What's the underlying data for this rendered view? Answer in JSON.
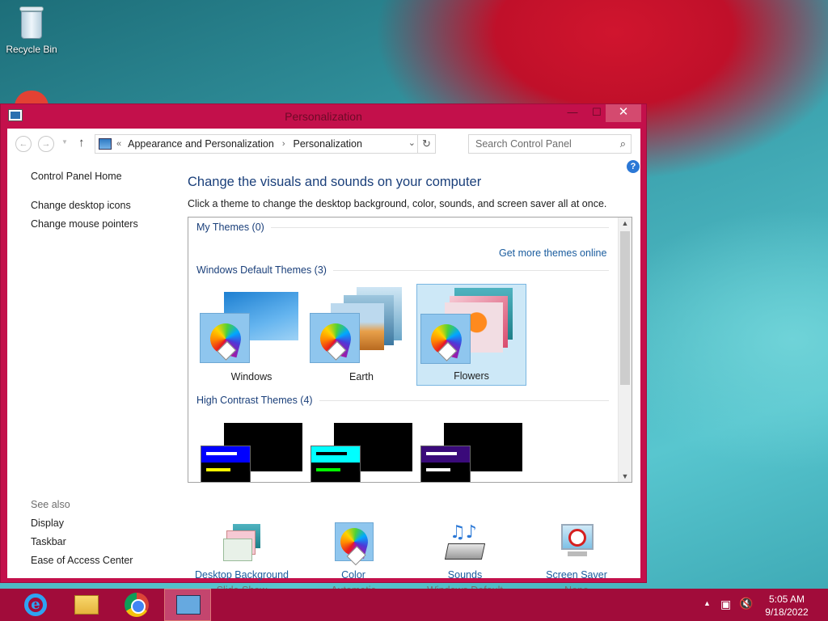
{
  "desktop": {
    "recycle_bin_label": "Recycle Bin"
  },
  "window": {
    "title": "Personalization",
    "controls": {
      "minimize": "—",
      "maximize": "☐",
      "close": "✕"
    }
  },
  "address": {
    "overflow": "«",
    "crumbs": [
      "Appearance and Personalization",
      "Personalization"
    ],
    "separator": "›"
  },
  "search": {
    "placeholder": "Search Control Panel"
  },
  "left_nav": {
    "home": "Control Panel Home",
    "items": [
      "Change desktop icons",
      "Change mouse pointers"
    ],
    "see_also_heading": "See also",
    "see_also": [
      "Display",
      "Taskbar",
      "Ease of Access Center"
    ]
  },
  "main": {
    "heading": "Change the visuals and sounds on your computer",
    "subheading": "Click a theme to change the desktop background, color, sounds, and screen saver all at once.",
    "help": "?"
  },
  "themes": {
    "my_themes_heading": "My Themes (0)",
    "get_more_link": "Get more themes online",
    "default_heading": "Windows Default Themes (3)",
    "default_themes": [
      {
        "name": "Windows",
        "selected": false
      },
      {
        "name": "Earth",
        "selected": false
      },
      {
        "name": "Flowers",
        "selected": true
      }
    ],
    "high_contrast_heading": "High Contrast Themes (4)",
    "hc_colors": [
      {
        "bar": "#0000ff",
        "l1": "#ffffff",
        "l2": "#ffff00"
      },
      {
        "bar": "#00ffff",
        "l1": "#000000",
        "l2": "#00ff00"
      },
      {
        "bar": "#3a0a7a",
        "l1": "#ffffff",
        "l2": "#ffffff"
      }
    ]
  },
  "bottom": [
    {
      "label": "Desktop Background",
      "value": "Slide Show",
      "icon": "desktop-background-icon"
    },
    {
      "label": "Color",
      "value": "Automatic",
      "icon": "color-icon"
    },
    {
      "label": "Sounds",
      "value": "Windows Default",
      "icon": "sounds-icon"
    },
    {
      "label": "Screen Saver",
      "value": "None",
      "icon": "screen-saver-icon"
    }
  ],
  "taskbar": {
    "apps": [
      "internet-explorer",
      "file-explorer",
      "chrome",
      "control-panel"
    ],
    "time": "5:05 AM",
    "date": "9/18/2022"
  }
}
